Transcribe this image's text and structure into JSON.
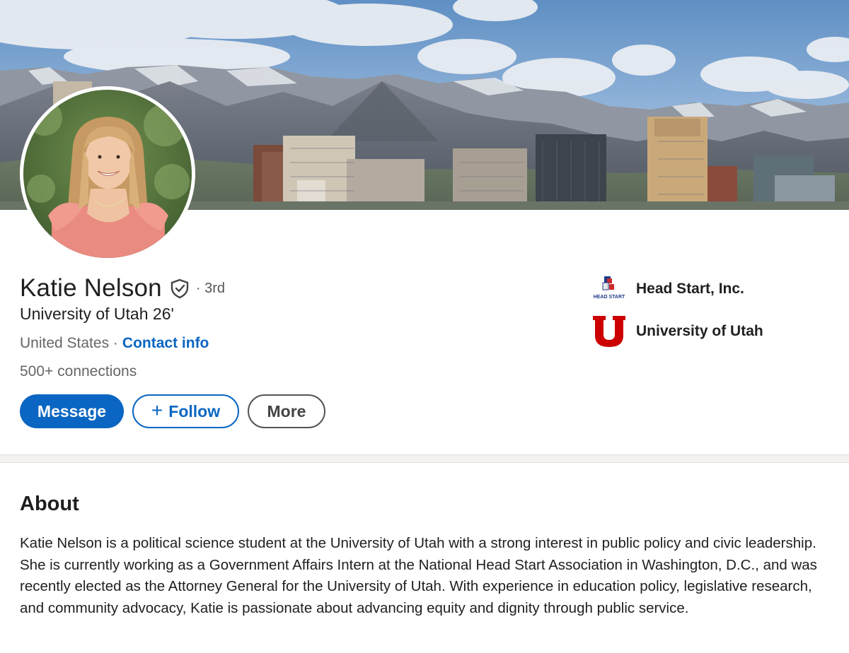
{
  "profile": {
    "name": "Katie Nelson",
    "degree": "· 3rd",
    "headline": "University of Utah 26'",
    "location": "United States ·",
    "contact_info": "Contact info",
    "connections": "500+ connections"
  },
  "actions": {
    "message": "Message",
    "follow_plus": "+",
    "follow": "Follow",
    "more": "More"
  },
  "organizations": [
    {
      "name": "Head Start, Inc.",
      "logo_text": "HEAD START",
      "icon": "head-start-logo"
    },
    {
      "name": "University of Utah",
      "icon": "university-of-utah-logo"
    }
  ],
  "about": {
    "title": "About",
    "text": "Katie Nelson is a political science student at the University of Utah with a strong interest in public policy and civic leadership. She is currently working as a Government Affairs Intern at the National Head Start Association in Washington, D.C., and was recently elected as the Attorney General for the University of Utah. With experience in education policy, legislative research, and community advocacy, Katie is passionate about advancing equity and dignity through public service."
  },
  "colors": {
    "primary_blue": "#0a66c2",
    "utah_red": "#cc0000",
    "text": "#1f1f1f",
    "muted": "#666666"
  }
}
